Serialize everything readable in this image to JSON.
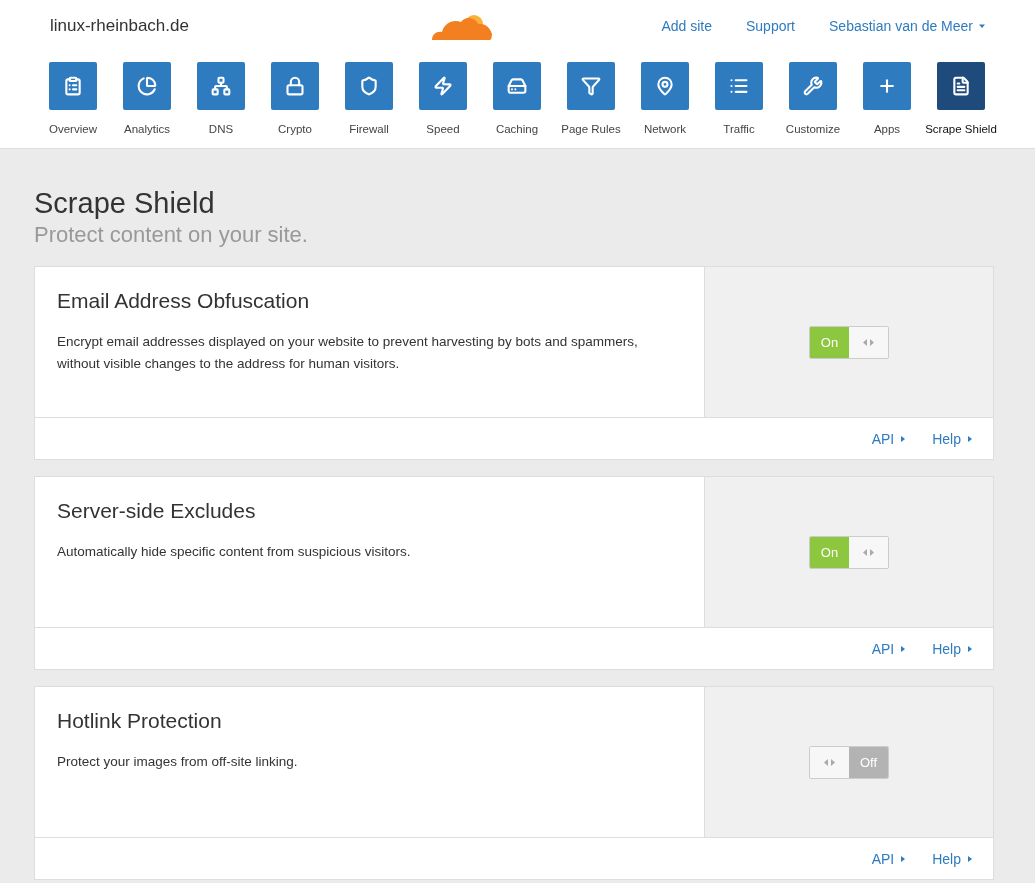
{
  "header": {
    "domain": "linux-rheinbach.de",
    "links": [
      "Add site",
      "Support"
    ],
    "user": "Sebastian van de Meer"
  },
  "nav": [
    {
      "kind": "overview",
      "label": "Overview",
      "selected": false
    },
    {
      "kind": "analytics",
      "label": "Analytics",
      "selected": false
    },
    {
      "kind": "dns",
      "label": "DNS",
      "selected": false
    },
    {
      "kind": "crypto",
      "label": "Crypto",
      "selected": false
    },
    {
      "kind": "firewall",
      "label": "Firewall",
      "selected": false
    },
    {
      "kind": "speed",
      "label": "Speed",
      "selected": false
    },
    {
      "kind": "caching",
      "label": "Caching",
      "selected": false
    },
    {
      "kind": "pagerules",
      "label": "Page Rules",
      "selected": false
    },
    {
      "kind": "network",
      "label": "Network",
      "selected": false
    },
    {
      "kind": "traffic",
      "label": "Traffic",
      "selected": false
    },
    {
      "kind": "customize",
      "label": "Customize",
      "selected": false
    },
    {
      "kind": "apps",
      "label": "Apps",
      "selected": false
    },
    {
      "kind": "scrape",
      "label": "Scrape Shield",
      "selected": true
    }
  ],
  "page": {
    "title": "Scrape Shield",
    "subtitle": "Protect content on your site."
  },
  "cards": [
    {
      "title": "Email Address Obfuscation",
      "description": "Encrypt email addresses displayed on your website to prevent harvesting by bots and spammers, without visible changes to the address for human visitors.",
      "on": true,
      "toggle_label": "On",
      "links": [
        "API",
        "Help"
      ]
    },
    {
      "title": "Server-side Excludes",
      "description": "Automatically hide specific content from suspicious visitors.",
      "on": true,
      "toggle_label": "On",
      "links": [
        "API",
        "Help"
      ]
    },
    {
      "title": "Hotlink Protection",
      "description": "Protect your images from off-site linking.",
      "on": false,
      "toggle_label": "Off",
      "links": [
        "API",
        "Help"
      ]
    }
  ]
}
